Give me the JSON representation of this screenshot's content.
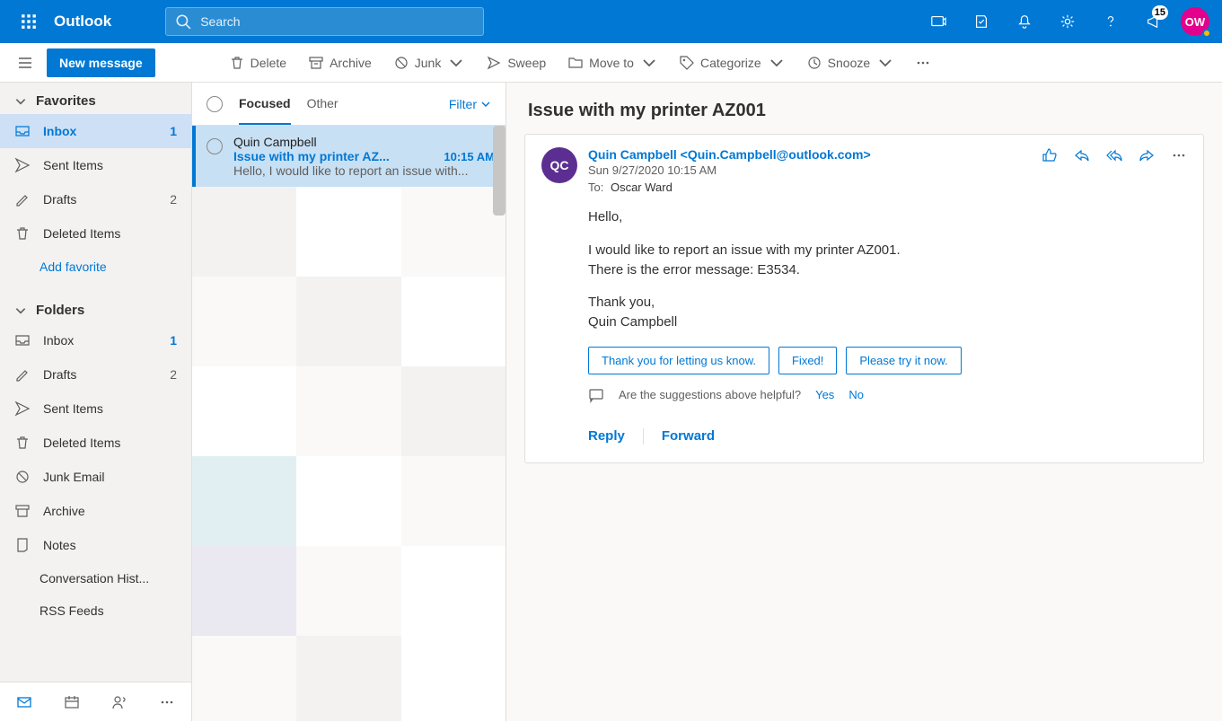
{
  "brand": "Outlook",
  "search_placeholder": "Search",
  "notification_badge": "15",
  "avatar_initials": "OW",
  "new_message_label": "New message",
  "commands": {
    "delete": "Delete",
    "archive": "Archive",
    "junk": "Junk",
    "sweep": "Sweep",
    "move_to": "Move to",
    "categorize": "Categorize",
    "snooze": "Snooze"
  },
  "nav": {
    "favorites_label": "Favorites",
    "folders_label": "Folders",
    "add_favorite": "Add favorite",
    "favorites": [
      {
        "icon": "inbox",
        "label": "Inbox",
        "count": "1",
        "selected": true
      },
      {
        "icon": "send",
        "label": "Sent Items",
        "count": ""
      },
      {
        "icon": "draft",
        "label": "Drafts",
        "count": "2"
      },
      {
        "icon": "trash",
        "label": "Deleted Items",
        "count": ""
      }
    ],
    "folders": [
      {
        "icon": "inbox",
        "label": "Inbox",
        "count": "1"
      },
      {
        "icon": "draft",
        "label": "Drafts",
        "count": "2"
      },
      {
        "icon": "send",
        "label": "Sent Items",
        "count": ""
      },
      {
        "icon": "trash",
        "label": "Deleted Items",
        "count": ""
      },
      {
        "icon": "junk",
        "label": "Junk Email",
        "count": ""
      },
      {
        "icon": "archive-box",
        "label": "Archive",
        "count": ""
      },
      {
        "icon": "note",
        "label": "Notes",
        "count": ""
      },
      {
        "icon": "",
        "label": "Conversation Hist...",
        "count": ""
      },
      {
        "icon": "",
        "label": "RSS Feeds",
        "count": ""
      }
    ]
  },
  "msglist": {
    "pivot_focused": "Focused",
    "pivot_other": "Other",
    "filter_label": "Filter",
    "item": {
      "from": "Quin Campbell",
      "subject": "Issue with my printer AZ...",
      "time": "10:15 AM",
      "preview": "Hello, I would like to report an issue with..."
    }
  },
  "reader": {
    "subject": "Issue with my printer AZ001",
    "avatar_initials": "QC",
    "from_display": "Quin Campbell <Quin.Campbell@outlook.com>",
    "date": "Sun 9/27/2020 10:15 AM",
    "to_label": "To:",
    "to_value": "Oscar Ward",
    "body_line1": "Hello,",
    "body_line2": "I would like to report an issue with my printer AZ001.",
    "body_line3": "There is the error message: E3534.",
    "body_line4": "Thank you,",
    "body_line5": "Quin Campbell",
    "suggestions": [
      "Thank you for letting us know.",
      "Fixed!",
      "Please try it now."
    ],
    "feedback_prompt": "Are the suggestions above helpful?",
    "feedback_yes": "Yes",
    "feedback_no": "No",
    "reply_label": "Reply",
    "forward_label": "Forward"
  }
}
